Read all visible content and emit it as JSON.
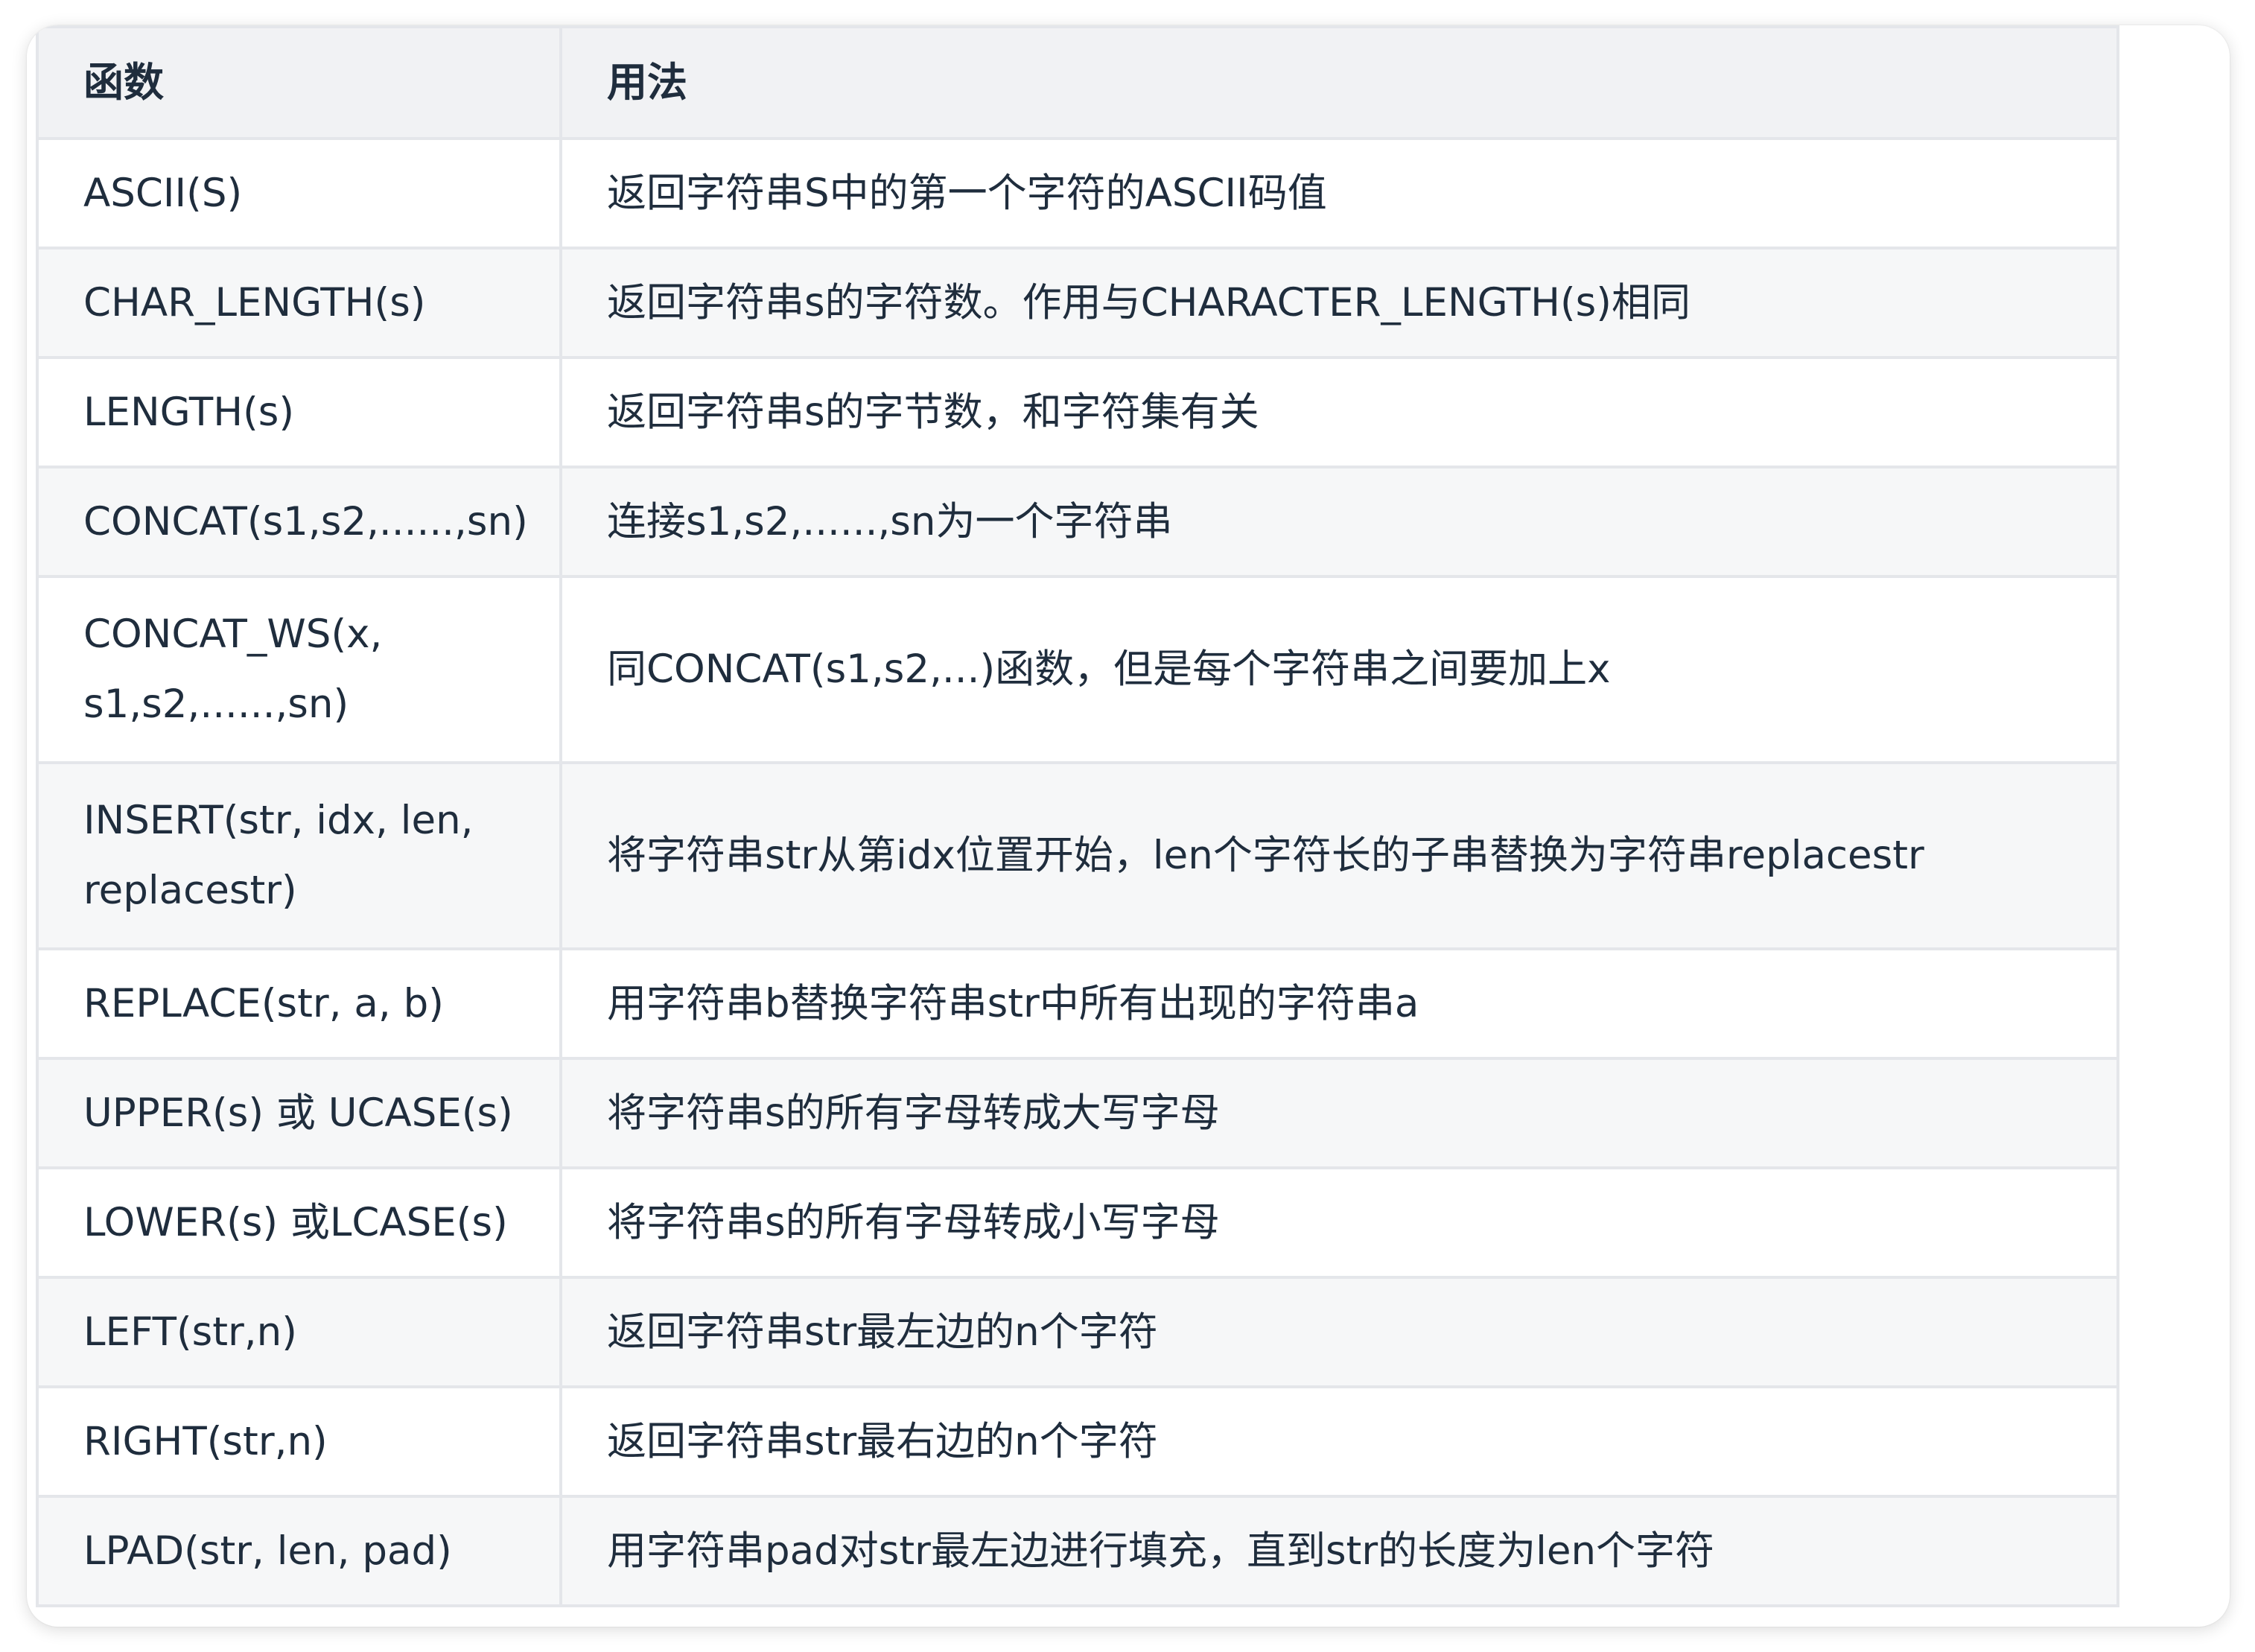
{
  "table": {
    "headers": [
      "函数",
      "用法"
    ],
    "rows": [
      [
        "ASCII(S)",
        "返回字符串S中的第一个字符的ASCII码值"
      ],
      [
        "CHAR_LENGTH(s)",
        "返回字符串s的字符数。作用与CHARACTER_LENGTH(s)相同"
      ],
      [
        "LENGTH(s)",
        "返回字符串s的字节数，和字符集有关"
      ],
      [
        "CONCAT(s1,s2,......,sn)",
        "连接s1,s2,......,sn为一个字符串"
      ],
      [
        "CONCAT_WS(x, s1,s2,......,sn)",
        "同CONCAT(s1,s2,...)函数，但是每个字符串之间要加上x"
      ],
      [
        "INSERT(str, idx, len, replacestr)",
        "将字符串str从第idx位置开始，len个字符长的子串替换为字符串replacestr"
      ],
      [
        "REPLACE(str, a, b)",
        "用字符串b替换字符串str中所有出现的字符串a"
      ],
      [
        "UPPER(s) 或 UCASE(s)",
        "将字符串s的所有字母转成大写字母"
      ],
      [
        "LOWER(s) 或LCASE(s)",
        "将字符串s的所有字母转成小写字母"
      ],
      [
        "LEFT(str,n)",
        "返回字符串str最左边的n个字符"
      ],
      [
        "RIGHT(str,n)",
        "返回字符串str最右边的n个字符"
      ],
      [
        "LPAD(str, len, pad)",
        "用字符串pad对str最左边进行填充，直到str的长度为len个字符"
      ]
    ]
  }
}
